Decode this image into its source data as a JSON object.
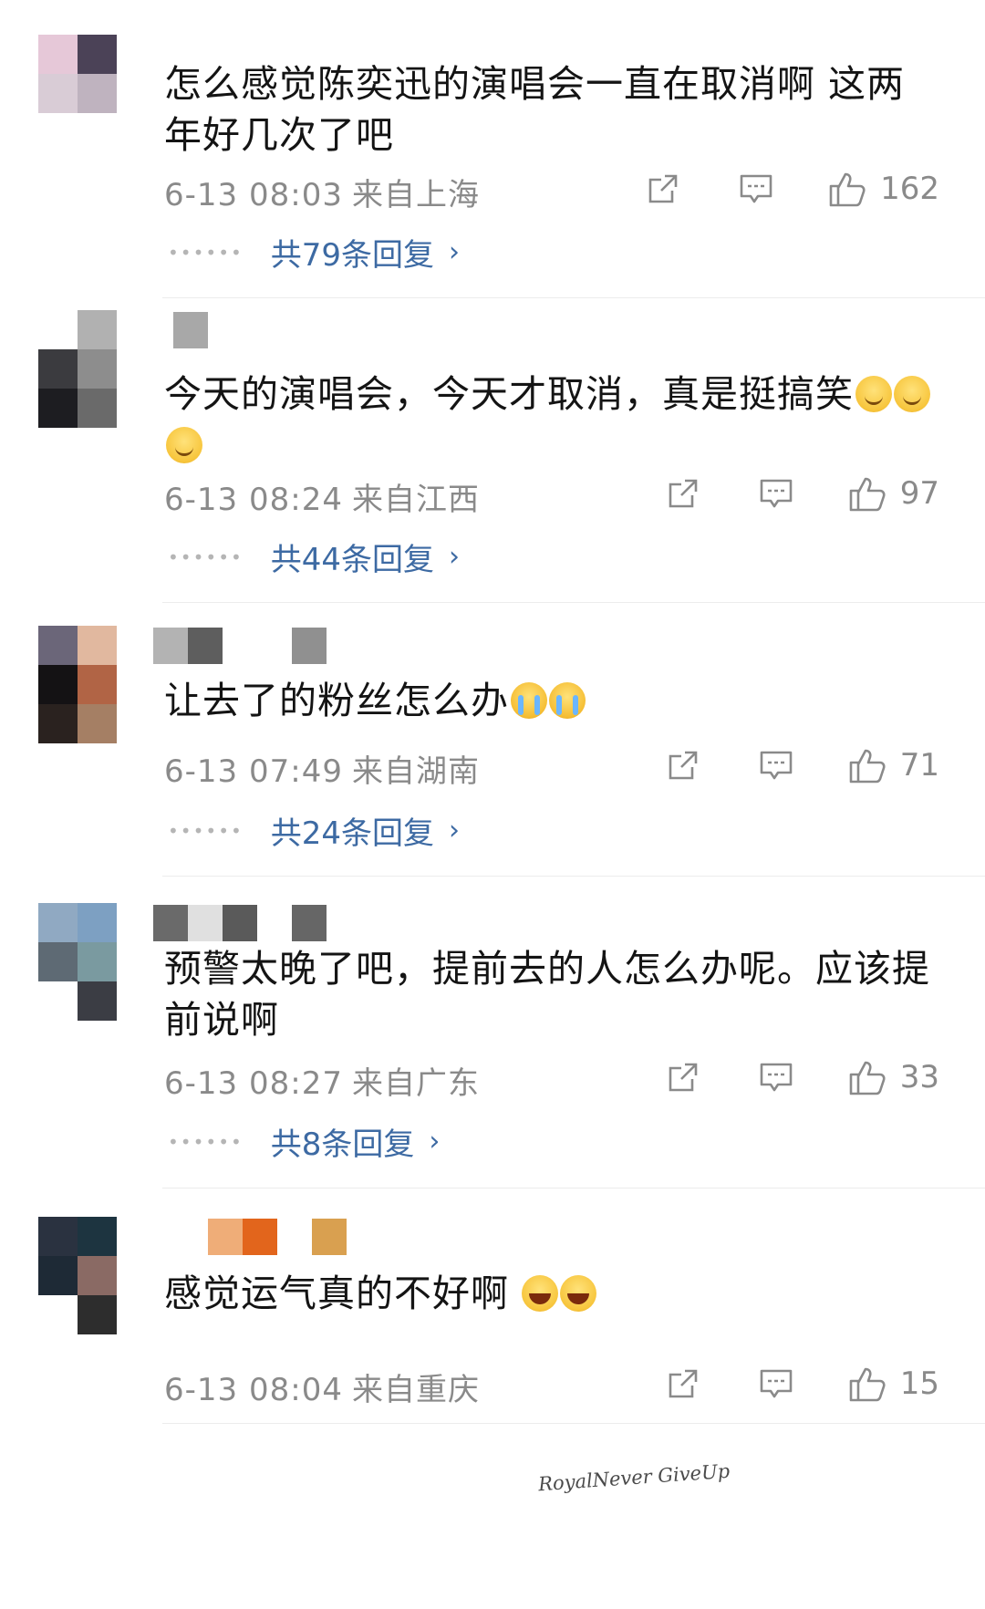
{
  "comments": [
    {
      "text": "怎么感觉陈奕迅的演唱会一直在取消啊 这两年好几次了吧",
      "time": "6-13 08:03",
      "location": "来自上海",
      "likes": "162",
      "replies_label": "共79条回复",
      "avatar_colors": [
        "#e6c8d8",
        "#4b4257",
        "#d9ccd6",
        "#bfb3bf"
      ],
      "username_colors": []
    },
    {
      "text": "今天的演唱会，今天才取消，真是挺搞笑",
      "emojis": [
        "smile-emoji",
        "smile-emoji",
        "smile-emoji"
      ],
      "time": "6-13 08:24",
      "location": "来自江西",
      "likes": "97",
      "replies_label": "共44条回复",
      "avatar_colors": [
        "#ffffff",
        "#b1b1b1",
        "#3b3b3f",
        "#8d8d8d",
        "#1d1d21",
        "#6a6a6a"
      ],
      "username_colors": [
        "#a8a8a8"
      ]
    },
    {
      "text": "让去了的粉丝怎么办",
      "emojis": [
        "cry-emoji",
        "cry-emoji"
      ],
      "time": "6-13 07:49",
      "location": "来自湖南",
      "likes": "71",
      "replies_label": "共24条回复",
      "avatar_colors": [
        "#6b6679",
        "#e1b89f",
        "#141214",
        "#b16445",
        "#2a221f",
        "#a57f64"
      ],
      "username_colors": [
        "#b3b3b3",
        "#5e5e5e",
        "#ffffff",
        "#909090"
      ]
    },
    {
      "text": "预警太晚了吧，提前去的人怎么办呢。应该提前说啊",
      "time": "6-13 08:27",
      "location": "来自广东",
      "likes": "33",
      "replies_label": "共8条回复",
      "avatar_colors": [
        "#90a9c2",
        "#7da0c2",
        "#5e6a74",
        "#7a9aa0",
        "#ffffff",
        "#3b3d44"
      ],
      "username_colors": [
        "#6a6a6a",
        "#e0e0e0",
        "#5a5a5a",
        "#ffffff",
        "#666666"
      ]
    },
    {
      "text": "感觉运气真的不好啊",
      "emojis": [
        "laugh-emoji",
        "laugh-emoji"
      ],
      "time": "6-13 08:04",
      "location": "来自重庆",
      "likes": "15",
      "avatar_colors": [
        "#2a3240",
        "#1d3440",
        "#1e2a36",
        "#8a6a64",
        "#ffffff",
        "#2d2d2d"
      ],
      "username_colors": [
        "#ffffff",
        "#efad78",
        "#e2651c",
        "#ffffff",
        "#d9a050"
      ]
    }
  ],
  "watermark": "RoyalNever GiveUp",
  "icons": {
    "share": "share-icon",
    "comment": "comment-icon",
    "like": "thumbs-up-icon",
    "chevron": "chevron-right-icon"
  }
}
